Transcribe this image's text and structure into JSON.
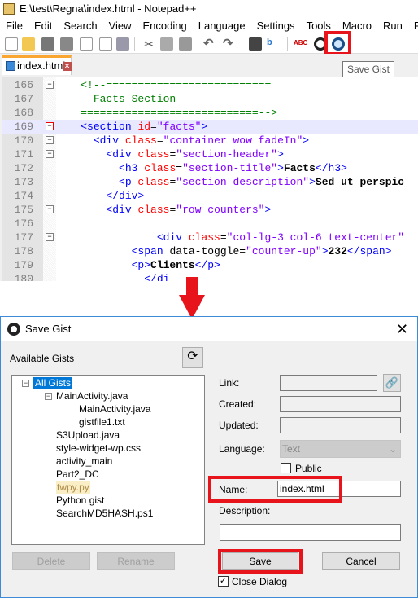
{
  "window": {
    "title": "E:\\test\\Regna\\index.html - Notepad++"
  },
  "menu": [
    "File",
    "Edit",
    "Search",
    "View",
    "Encoding",
    "Language",
    "Settings",
    "Tools",
    "Macro",
    "Run",
    "Plugin"
  ],
  "toolbar": {
    "tooltip": "Save Gist",
    "highlighted": "save-gist-icon"
  },
  "tab": {
    "label": "index.html"
  },
  "editor": {
    "current_line": 169,
    "lines": [
      {
        "n": 166,
        "fold": "box",
        "tokens": [
          [
            "sp",
            "    "
          ],
          [
            "com",
            "<!--=========================="
          ]
        ]
      },
      {
        "n": 167,
        "fold": "",
        "tokens": [
          [
            "sp",
            "      "
          ],
          [
            "com",
            "Facts Section"
          ]
        ]
      },
      {
        "n": 168,
        "fold": "",
        "tokens": [
          [
            "sp",
            "    "
          ],
          [
            "com",
            "============================-->"
          ]
        ]
      },
      {
        "n": 169,
        "fold": "red",
        "tokens": [
          [
            "sp",
            "    "
          ],
          [
            "tag",
            "<section "
          ],
          [
            "attr",
            "id"
          ],
          [
            "sp",
            "="
          ],
          [
            "val",
            "\"facts\""
          ],
          [
            "tag",
            ">"
          ]
        ]
      },
      {
        "n": 170,
        "fold": "box",
        "tokens": [
          [
            "sp",
            "      "
          ],
          [
            "tag",
            "<div "
          ],
          [
            "attr",
            "class"
          ],
          [
            "sp",
            "="
          ],
          [
            "val",
            "\"container wow fadeIn\""
          ],
          [
            "tag",
            ">"
          ]
        ]
      },
      {
        "n": 171,
        "fold": "box",
        "tokens": [
          [
            "sp",
            "        "
          ],
          [
            "tag",
            "<div "
          ],
          [
            "attr",
            "class"
          ],
          [
            "sp",
            "="
          ],
          [
            "val",
            "\"section-header\""
          ],
          [
            "tag",
            ">"
          ]
        ]
      },
      {
        "n": 172,
        "fold": "",
        "tokens": [
          [
            "sp",
            "          "
          ],
          [
            "tag",
            "<h3 "
          ],
          [
            "attr",
            "class"
          ],
          [
            "sp",
            "="
          ],
          [
            "val",
            "\"section-title\""
          ],
          [
            "tag",
            ">"
          ],
          [
            "txt",
            "Facts"
          ],
          [
            "tag",
            "</h3>"
          ]
        ]
      },
      {
        "n": 173,
        "fold": "",
        "tokens": [
          [
            "sp",
            "          "
          ],
          [
            "tag",
            "<p "
          ],
          [
            "attr",
            "class"
          ],
          [
            "sp",
            "="
          ],
          [
            "val",
            "\"section-description\""
          ],
          [
            "tag",
            ">"
          ],
          [
            "txt",
            "Sed ut perspic"
          ]
        ]
      },
      {
        "n": 174,
        "fold": "",
        "tokens": [
          [
            "sp",
            "        "
          ],
          [
            "tag",
            "</div>"
          ]
        ]
      },
      {
        "n": 175,
        "fold": "box",
        "tokens": [
          [
            "sp",
            "        "
          ],
          [
            "tag",
            "<div "
          ],
          [
            "attr",
            "class"
          ],
          [
            "sp",
            "="
          ],
          [
            "val",
            "\"row counters\""
          ],
          [
            "tag",
            ">"
          ]
        ]
      },
      {
        "n": 176,
        "fold": "",
        "tokens": []
      },
      {
        "n": 177,
        "fold": "box",
        "tokens": [
          [
            "sp",
            "                "
          ],
          [
            "tag",
            "<div "
          ],
          [
            "attr",
            "class"
          ],
          [
            "sp",
            "="
          ],
          [
            "val",
            "\"col-lg-3 col-6 text-center\""
          ]
        ]
      },
      {
        "n": 178,
        "fold": "",
        "tokens": [
          [
            "sp",
            "            "
          ],
          [
            "tag",
            "<span "
          ],
          [
            "sp",
            "data-toggle="
          ],
          [
            "val",
            "\"counter-up\""
          ],
          [
            "tag",
            ">"
          ],
          [
            "txt",
            "232"
          ],
          [
            "tag",
            "</span>"
          ]
        ]
      },
      {
        "n": 179,
        "fold": "",
        "tokens": [
          [
            "sp",
            "            "
          ],
          [
            "tag",
            "<p>"
          ],
          [
            "txt",
            "Clients"
          ],
          [
            "tag",
            "</p>"
          ]
        ]
      },
      {
        "n": 180,
        "fold": "",
        "tokens": [
          [
            "sp",
            "              "
          ],
          [
            "tag",
            "</di"
          ]
        ]
      }
    ]
  },
  "dialog": {
    "title": "Save Gist",
    "available_label": "Available Gists",
    "tree": [
      {
        "label": "All Gists",
        "level": 0,
        "expander": "−",
        "state": "selected"
      },
      {
        "label": "MainActivity.java",
        "level": 1,
        "expander": "−"
      },
      {
        "label": "MainActivity.java",
        "level": 2
      },
      {
        "label": "gistfile1.txt",
        "level": 2
      },
      {
        "label": "S3Upload.java",
        "level": 1
      },
      {
        "label": "style-widget-wp.css",
        "level": 1
      },
      {
        "label": "activity_main",
        "level": 1
      },
      {
        "label": "Part2_DC",
        "level": 1
      },
      {
        "label": "twpy.py",
        "level": 1,
        "state": "hot"
      },
      {
        "label": "Python gist",
        "level": 1
      },
      {
        "label": "SearchMD5HASH.ps1",
        "level": 1
      }
    ],
    "delete_label": "Delete",
    "rename_label": "Rename",
    "link_label": "Link:",
    "link_value": "",
    "created_label": "Created:",
    "created_value": "",
    "updated_label": "Updated:",
    "updated_value": "",
    "language_label": "Language:",
    "language_value": "Text",
    "public_label": "Public",
    "public_checked": false,
    "name_label": "Name:",
    "name_value": "index.html",
    "description_label": "Description:",
    "description_value": "",
    "save_label": "Save",
    "cancel_label": "Cancel",
    "close_dialog_label": "Close Dialog",
    "close_dialog_checked": true
  },
  "colors": {
    "highlight_red": "#e8141c",
    "selection": "#0078d7",
    "tag": "#0000ff",
    "attr": "#ff0000",
    "value": "#8000ff",
    "comment": "#008000"
  }
}
